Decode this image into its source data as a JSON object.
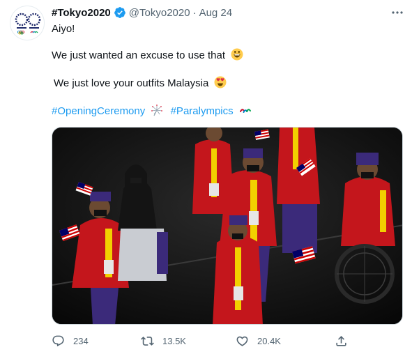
{
  "tweet": {
    "display_name": "#Tokyo2020",
    "handle": "@Tokyo2020",
    "separator": "·",
    "date": "Aug 24",
    "verified_icon": "verified-badge-icon",
    "more_icon": "more-options-icon",
    "lines": {
      "l1": "Aiyo!",
      "l2": "We just wanted an excuse to use that",
      "l3": "We just love your outfits Malaysia"
    },
    "emojis": {
      "grin": "grinning-face-emoji",
      "heart_eyes": "heart-eyes-emoji",
      "sparkler": "sparkler-emoji",
      "paralympic": "paralympics-agitos-emoji"
    },
    "hashtags": [
      "#OpeningCeremony",
      "#Paralympics"
    ],
    "media": {
      "description_icon": "photo-malaysian-athletes-opening-ceremony"
    },
    "actions": {
      "reply": {
        "icon": "reply-icon",
        "count": "234"
      },
      "retweet": {
        "icon": "retweet-icon",
        "count": "13.5K"
      },
      "like": {
        "icon": "like-icon",
        "count": "20.4K"
      },
      "share": {
        "icon": "share-icon"
      }
    },
    "colors": {
      "link": "#1d9bf0",
      "text": "#0f1419",
      "secondary": "#536471"
    }
  }
}
